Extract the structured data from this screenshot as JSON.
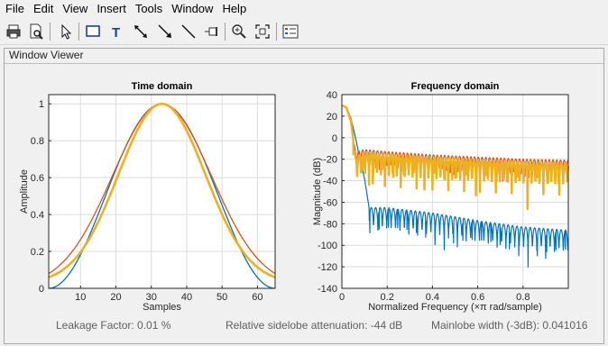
{
  "menu": [
    "File",
    "Edit",
    "View",
    "Insert",
    "Tools",
    "Window",
    "Help"
  ],
  "toolbar": {
    "buttons": [
      {
        "name": "print-icon"
      },
      {
        "name": "print-preview-icon"
      },
      {
        "name": "select-arrow-icon"
      },
      {
        "name": "rectangle-icon"
      },
      {
        "name": "text-icon"
      },
      {
        "name": "double-arrow-icon"
      },
      {
        "name": "arrow-icon"
      },
      {
        "name": "line-icon"
      },
      {
        "name": "pin-icon"
      },
      {
        "name": "zoom-in-icon"
      },
      {
        "name": "full-view-icon"
      },
      {
        "name": "legend-icon"
      }
    ]
  },
  "panel": {
    "title": "Window Viewer"
  },
  "status": {
    "leakage": "Leakage Factor: 0.01 %",
    "sidelobe": "Relative sidelobe attenuation: -44 dB",
    "mainlobe": "Mainlobe width (-3dB): 0.041016"
  },
  "chart_data": [
    {
      "type": "line",
      "title": "Time domain",
      "xlabel": "Samples",
      "ylabel": "Amplitude",
      "xlim": [
        1,
        65
      ],
      "ylim": [
        0,
        1.05
      ],
      "xticks": [
        10,
        20,
        30,
        40,
        50,
        60
      ],
      "yticks": [
        0,
        0.2,
        0.4,
        0.6,
        0.8,
        1
      ],
      "grid": true,
      "center_sample": 33,
      "series": [
        {
          "color": "#0072bd",
          "x": [
            1,
            5,
            9,
            13,
            17,
            21,
            25,
            29,
            33,
            37,
            41,
            45,
            49,
            53,
            57,
            61,
            65
          ],
          "y": [
            0.0,
            0.01,
            0.05,
            0.12,
            0.23,
            0.38,
            0.58,
            0.85,
            1.0,
            0.85,
            0.58,
            0.38,
            0.23,
            0.12,
            0.05,
            0.01,
            0.0
          ]
        },
        {
          "color": "#d95319",
          "x": [
            1,
            5,
            9,
            13,
            17,
            21,
            25,
            29,
            33,
            37,
            41,
            45,
            49,
            53,
            57,
            61,
            65
          ],
          "y": [
            0.08,
            0.12,
            0.22,
            0.35,
            0.5,
            0.65,
            0.81,
            0.95,
            1.0,
            0.95,
            0.81,
            0.65,
            0.5,
            0.35,
            0.22,
            0.12,
            0.08
          ]
        },
        {
          "color": "#edb120",
          "x": [
            1,
            5,
            9,
            13,
            17,
            21,
            25,
            29,
            33,
            37,
            41,
            45,
            49,
            53,
            57,
            61,
            65
          ],
          "y": [
            0.06,
            0.1,
            0.17,
            0.29,
            0.43,
            0.59,
            0.76,
            0.92,
            1.0,
            0.92,
            0.76,
            0.59,
            0.43,
            0.29,
            0.17,
            0.1,
            0.06
          ]
        }
      ]
    },
    {
      "type": "line",
      "title": "Frequency domain",
      "xlabel": "Normalized  Frequency  (×π rad/sample)",
      "ylabel": "Magnitude (dB)",
      "xlim": [
        0,
        1
      ],
      "ylim": [
        -140,
        40
      ],
      "xticks": [
        0,
        0.2,
        0.4,
        0.6,
        0.8
      ],
      "yticks": [
        -140,
        -120,
        -100,
        -80,
        -60,
        -40,
        -20,
        0,
        20,
        40
      ],
      "grid": true,
      "series": [
        {
          "color": "#0072bd",
          "x": [
            0,
            0.02,
            0.04,
            0.06,
            0.08,
            0.1,
            0.12,
            0.2,
            0.4,
            0.6,
            0.8,
            1.0
          ],
          "y": [
            30,
            28,
            18,
            0,
            -20,
            -38,
            -65,
            -65,
            -70,
            -77,
            -83,
            -86
          ]
        },
        {
          "color": "#d95319",
          "x": [
            0,
            0.02,
            0.04,
            0.06,
            0.1,
            0.2,
            0.4,
            0.6,
            0.8,
            1.0
          ],
          "y": [
            30,
            28,
            18,
            -13,
            -11,
            -13,
            -16,
            -18,
            -20,
            -21
          ]
        },
        {
          "color": "#edb120",
          "x": [
            0,
            0.02,
            0.04,
            0.06,
            0.1,
            0.2,
            0.4,
            0.6,
            0.8,
            1.0
          ],
          "y": [
            30,
            28,
            15,
            -18,
            -14,
            -16,
            -19,
            -21,
            -23,
            -24
          ]
        }
      ]
    }
  ]
}
